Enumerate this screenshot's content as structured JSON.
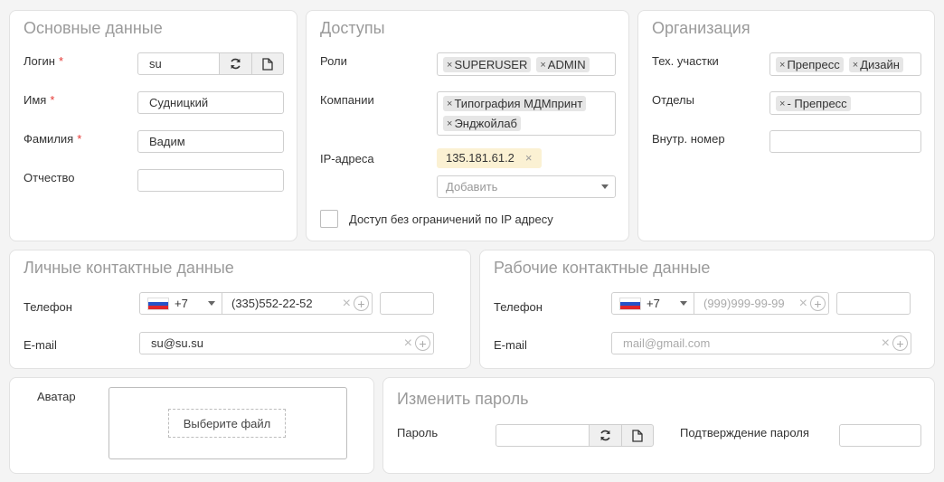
{
  "basic": {
    "title": "Основные данные",
    "login_label": "Логин",
    "login_value": "su",
    "name_label": "Имя",
    "name_value": "Судницкий",
    "surname_label": "Фамилия",
    "surname_value": "Вадим",
    "patronymic_label": "Отчество",
    "patronymic_value": "",
    "required_mark": "*"
  },
  "access": {
    "title": "Доступы",
    "roles_label": "Роли",
    "roles": [
      "SUPERUSER",
      "ADMIN"
    ],
    "companies_label": "Компании",
    "companies": [
      "Типография МДМпринт",
      "Энджойлаб"
    ],
    "ip_label": "IP-адреса",
    "ip_value": "135.181.61.2",
    "ip_add_placeholder": "Добавить",
    "no_ip_limit_label": "Доступ без ограничений по IP адресу"
  },
  "org": {
    "title": "Организация",
    "sites_label": "Тех. участки",
    "sites": [
      "Препресс",
      "Дизайн"
    ],
    "departments_label": "Отделы",
    "departments": [
      "- Препресс"
    ],
    "ext_label": "Внутр. номер",
    "ext_value": ""
  },
  "personal": {
    "title": "Личные контактные данные",
    "phone_label": "Телефон",
    "country_code": "+7",
    "phone_value": "(335)552-22-52",
    "email_label": "E-mail",
    "email_value": "su@su.su"
  },
  "work": {
    "title": "Рабочие контактные данные",
    "phone_label": "Телефон",
    "country_code": "+7",
    "phone_placeholder": "(999)999-99-99",
    "email_label": "E-mail",
    "email_placeholder": "mail@gmail.com"
  },
  "avatar": {
    "label": "Аватар",
    "choose_file": "Выберите файл"
  },
  "password": {
    "title": "Изменить пароль",
    "password_label": "Пароль",
    "confirm_label": "Подтверждение пароля"
  },
  "icons": {
    "remove_glyph": "×",
    "add_glyph": "+"
  },
  "colors": {
    "required": "#e53935",
    "ip_chip_bg": "#fbf1d3",
    "flag_white": "#ffffff",
    "flag_blue": "#2553c9",
    "flag_red": "#e0262b"
  }
}
